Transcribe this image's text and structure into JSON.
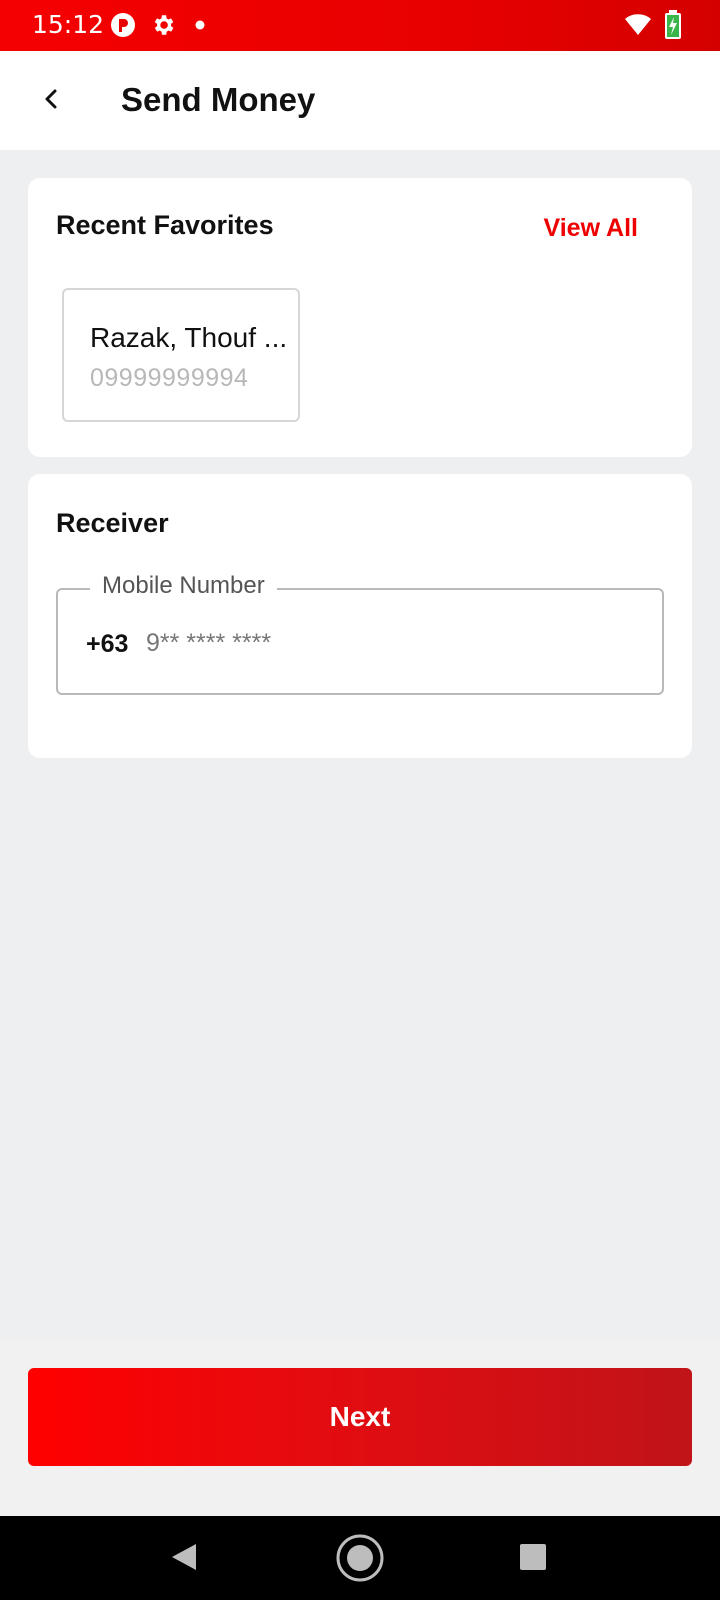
{
  "status_bar": {
    "time": "15:12",
    "icons_left": [
      "app-notification-icon",
      "settings-gear-icon",
      "dot-icon"
    ],
    "icons_right": [
      "wifi-icon",
      "battery-charging-icon"
    ],
    "background": "#e80000"
  },
  "app_bar": {
    "title": "Send Money",
    "back_icon": "chevron-left-icon"
  },
  "favorites": {
    "heading": "Recent Favorites",
    "view_all_label": "View All",
    "items": [
      {
        "name": "Razak, Thouf ...",
        "number": "09999999994"
      }
    ]
  },
  "receiver": {
    "heading": "Receiver",
    "field_label": "Mobile Number",
    "country_code": "+63",
    "value": "",
    "placeholder": "9** **** ****"
  },
  "actions": {
    "next_label": "Next"
  },
  "colors": {
    "accent": "#ee0000",
    "background": "#eeeff1"
  }
}
